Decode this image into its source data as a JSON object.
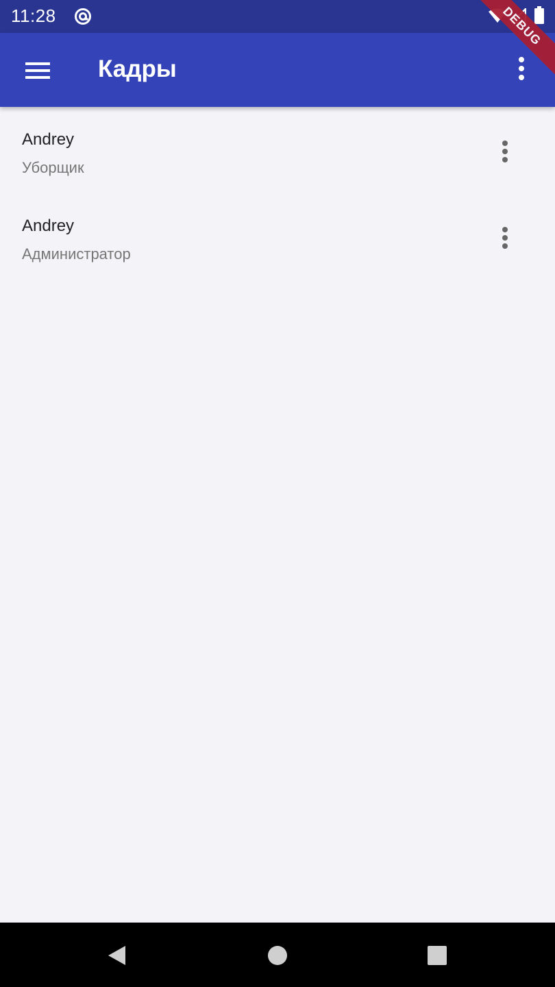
{
  "status_bar": {
    "time": "11:28",
    "icons": [
      "at-sign-icon",
      "wifi-icon",
      "signal-icon",
      "battery-icon"
    ]
  },
  "debug_banner": {
    "label": "DEBUG"
  },
  "app_bar": {
    "title": "Кадры",
    "menu_icon": "hamburger-menu-icon",
    "overflow_icon": "more-vert-icon"
  },
  "staff": [
    {
      "name": "Andrey",
      "role": "Уборщик"
    },
    {
      "name": "Andrey",
      "role": "Администратор"
    }
  ],
  "nav_bar": {
    "icons": [
      "back-icon",
      "home-icon",
      "recents-icon"
    ]
  },
  "colors": {
    "status_bar": "#2a3592",
    "app_bar": "#3443b8",
    "background": "#f4f4f8",
    "debug_banner": "#a81e34"
  }
}
